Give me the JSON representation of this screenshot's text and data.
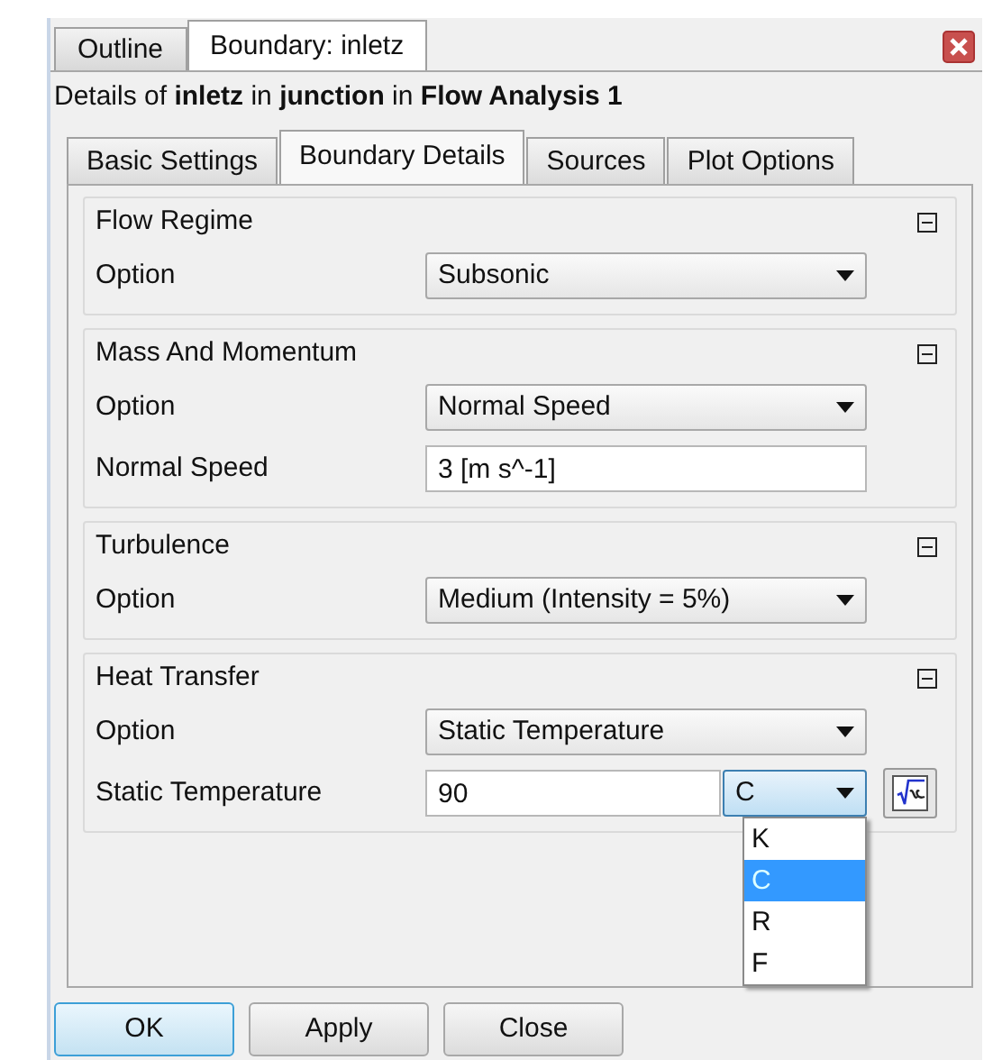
{
  "panel_tabs": [
    {
      "label": "Outline",
      "selected": false
    },
    {
      "label": "Boundary: inletz",
      "selected": true
    }
  ],
  "details": "Details of **inletz** in **junction** in **Flow Analysis 1**",
  "tabs": [
    {
      "label": "Basic Settings",
      "selected": false
    },
    {
      "label": "Boundary Details",
      "selected": true
    },
    {
      "label": "Sources",
      "selected": false
    },
    {
      "label": "Plot Options",
      "selected": false
    }
  ],
  "groups": [
    {
      "title": "Flow Regime",
      "expanded": true,
      "rows": [
        {
          "kind": "select",
          "label": "Option",
          "value": "Subsonic"
        }
      ]
    },
    {
      "title": "Mass And Momentum",
      "expanded": true,
      "rows": [
        {
          "kind": "select",
          "label": "Option",
          "value": "Normal Speed"
        },
        {
          "kind": "text",
          "label": "Normal Speed",
          "value": "3 [m s^-1]"
        }
      ]
    },
    {
      "title": "Turbulence",
      "expanded": true,
      "rows": [
        {
          "kind": "select",
          "label": "Option",
          "value": "Medium (Intensity = 5%)"
        }
      ]
    },
    {
      "title": "Heat Transfer",
      "expanded": true,
      "rows": [
        {
          "kind": "select",
          "label": "Option",
          "value": "Static Temperature"
        },
        {
          "kind": "unit",
          "label": "Static Temperature",
          "value": "90",
          "unit": "C",
          "menu_open": true,
          "unit_options": [
            {
              "label": "K",
              "selected": false
            },
            {
              "label": "C",
              "selected": true
            },
            {
              "label": "R",
              "selected": false
            },
            {
              "label": "F",
              "selected": false
            }
          ]
        }
      ]
    }
  ],
  "buttons": [
    {
      "label": "OK",
      "default": true
    },
    {
      "label": "Apply",
      "default": false
    },
    {
      "label": "Close",
      "default": false
    }
  ]
}
